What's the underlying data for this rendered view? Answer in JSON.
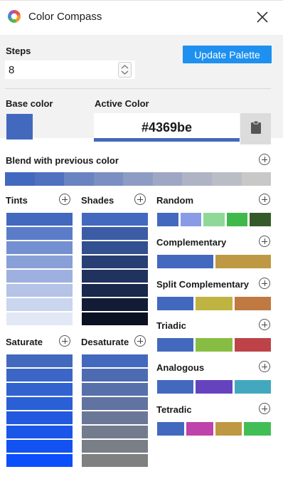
{
  "header": {
    "title": "Color Compass",
    "logo_icon": "color-wheel-icon",
    "close_icon": "close-icon"
  },
  "controls": {
    "steps_label": "Steps",
    "steps_value": "8",
    "update_button": "Update Palette",
    "base_label": "Base color",
    "active_label": "Active Color",
    "active_hex": "#4369be",
    "base_color": "#4369be",
    "clipboard_icon": "clipboard-icon"
  },
  "blend": {
    "label": "Blend with previous color",
    "colors": [
      "#4369be",
      "#5071bf",
      "#6a83c1",
      "#7b8fc2",
      "#8d9cc3",
      "#9ea8c4",
      "#afb4c5",
      "#bbbdc6",
      "#c8c8c8"
    ]
  },
  "sections": {
    "tints": {
      "label": "Tints",
      "colors": [
        "#4369be",
        "#5b7dc9",
        "#7490d1",
        "#889fd8",
        "#9db0df",
        "#b4c3e6",
        "#cad5ee",
        "#e2e8f6"
      ]
    },
    "shades": {
      "label": "Shades",
      "colors": [
        "#4369be",
        "#3c5ca5",
        "#324f8f",
        "#283f74",
        "#20335f",
        "#19284b",
        "#121c36",
        "#0b1122"
      ]
    },
    "saturate": {
      "label": "Saturate",
      "colors": [
        "#4369be",
        "#3b66c6",
        "#3262cf",
        "#2b5fd6",
        "#2259df",
        "#1a56e7",
        "#1152f1",
        "#0a4ffa"
      ]
    },
    "desaturate": {
      "label": "Desaturate",
      "colors": [
        "#4369be",
        "#4c6bb1",
        "#5770a9",
        "#6173a0",
        "#6a7797",
        "#737b8e",
        "#7a7e87",
        "#7f8080"
      ]
    },
    "random": {
      "label": "Random",
      "colors": [
        "#4369be",
        "#8a9be6",
        "#8fd898",
        "#3fba4a",
        "#355a2a"
      ]
    },
    "complementary": {
      "label": "Complementary",
      "colors": [
        "#4369be",
        "#be9843"
      ]
    },
    "split_complementary": {
      "label": "Split Complementary",
      "colors": [
        "#4369be",
        "#bfb441",
        "#bf7941"
      ]
    },
    "triadic": {
      "label": "Triadic",
      "colors": [
        "#4369be",
        "#88bd43",
        "#bd4349"
      ]
    },
    "analogous": {
      "label": "Analogous",
      "colors": [
        "#4369be",
        "#6643be",
        "#43a8be"
      ]
    },
    "tetradic": {
      "label": "Tetradic",
      "colors": [
        "#4369be",
        "#be43aa",
        "#be9843",
        "#43be56"
      ]
    }
  }
}
